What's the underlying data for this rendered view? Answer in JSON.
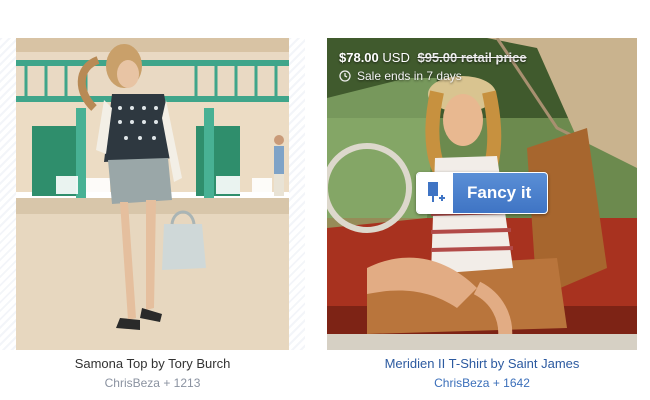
{
  "items": [
    {
      "title": "Samona Top by Tory Burch",
      "user": "ChrisBeza",
      "plus": "+",
      "count": "1213"
    },
    {
      "title": "Meridien II T-Shirt by Saint James",
      "user": "ChrisBeza",
      "plus": "+",
      "count": "1642",
      "price": "$78.00",
      "currency": "USD",
      "retail": "$95.00 retail price",
      "sale": "Sale ends in 7 days",
      "fancy_label": "Fancy it"
    }
  ],
  "colors": {
    "accent": "#3f74c4",
    "link": "#2c5aa0",
    "meta": "#8a92a0"
  },
  "icons": {
    "clock": "clock-icon",
    "fancy": "popsicle-plus-icon"
  }
}
